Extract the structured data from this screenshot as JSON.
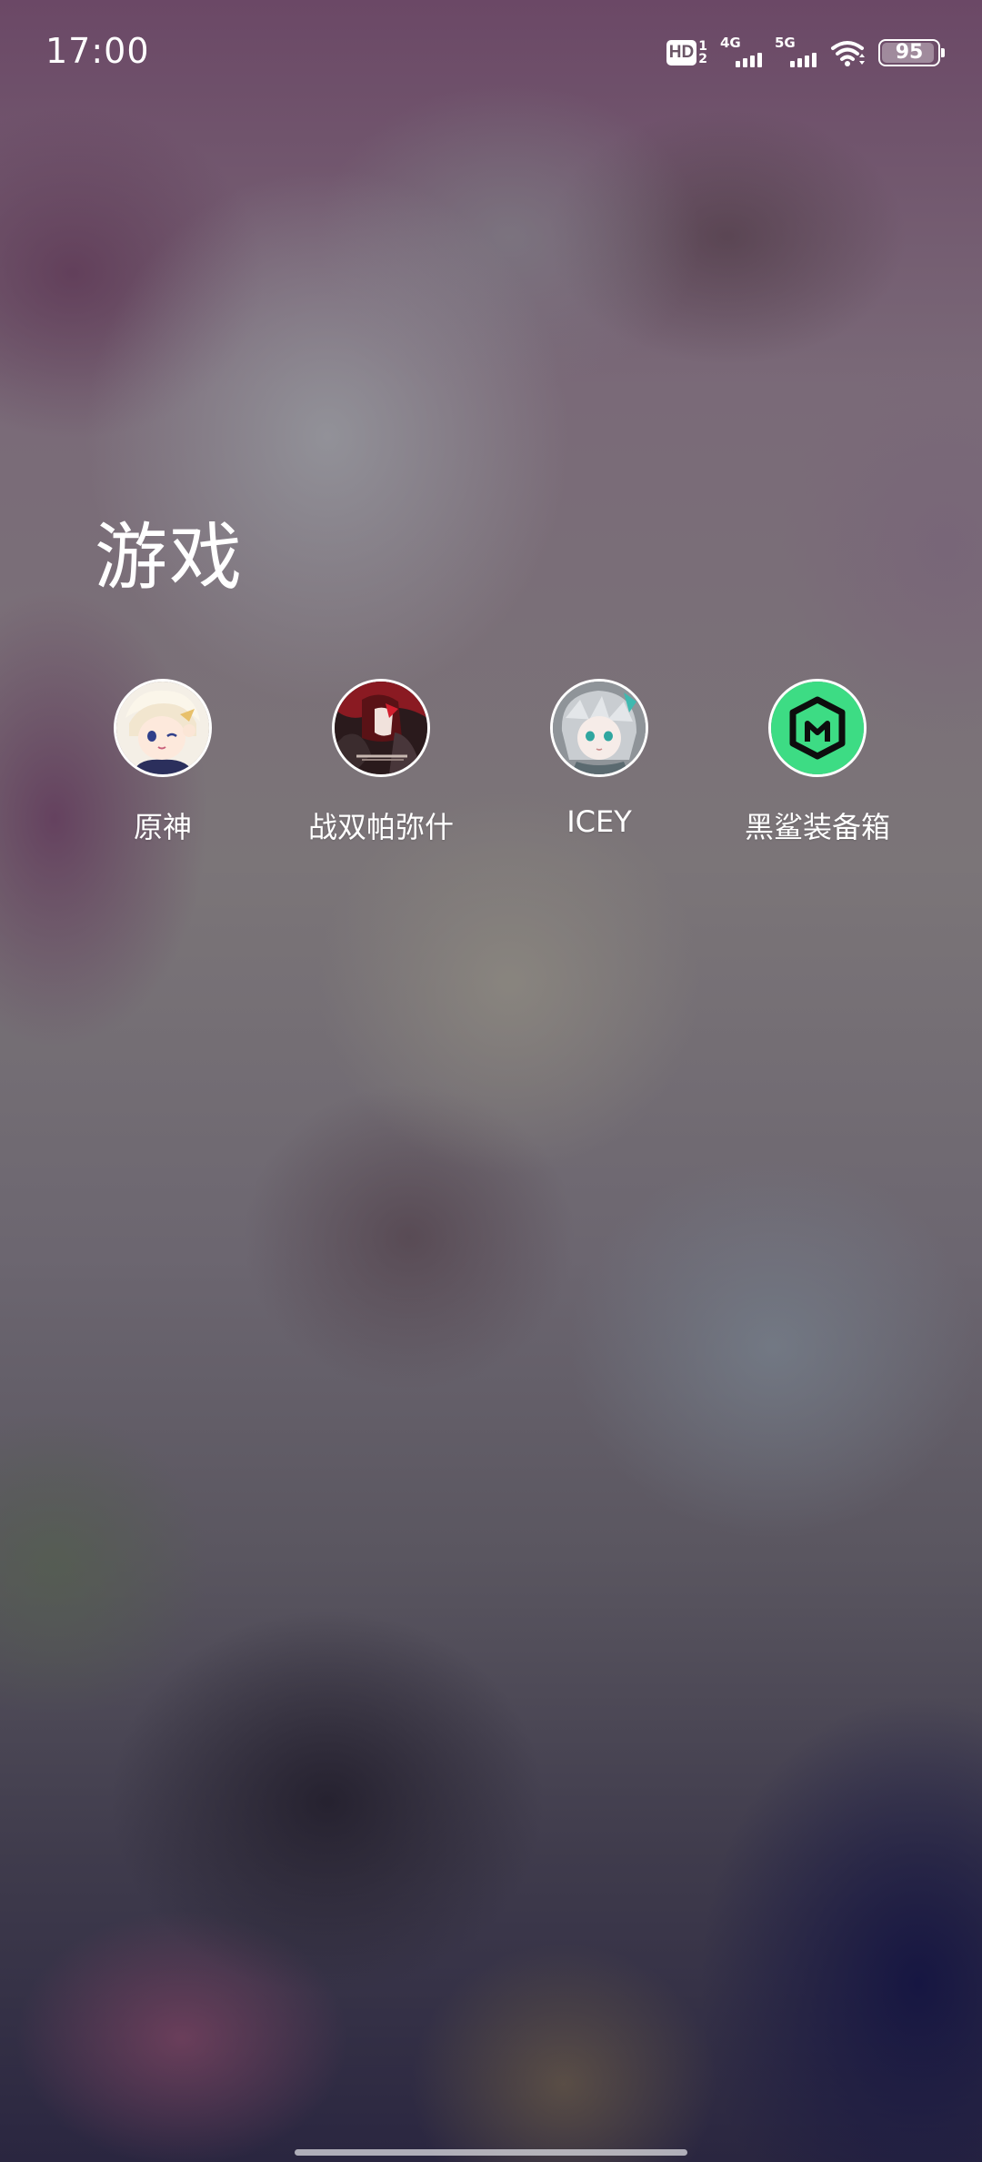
{
  "status_bar": {
    "time": "17:00",
    "hd_label": "HD",
    "hd_sub_top": "1",
    "hd_sub_bottom": "2",
    "signal_1_label": "4G",
    "signal_2_label": "5G",
    "battery_level": "95",
    "icons": [
      "hd-voice-icon",
      "signal-4g-icon",
      "signal-5g-icon",
      "wifi-icon",
      "battery-icon"
    ]
  },
  "folder": {
    "title": "游戏",
    "apps": [
      {
        "label": "原神",
        "icon": "genshin-impact-icon"
      },
      {
        "label": "战双帕弥什",
        "icon": "punishing-gray-raven-icon"
      },
      {
        "label": "ICEY",
        "icon": "icey-icon"
      },
      {
        "label": "黑鲨装备箱",
        "icon": "black-shark-gamebox-icon",
        "icon_color": "#3ddc84"
      }
    ]
  }
}
